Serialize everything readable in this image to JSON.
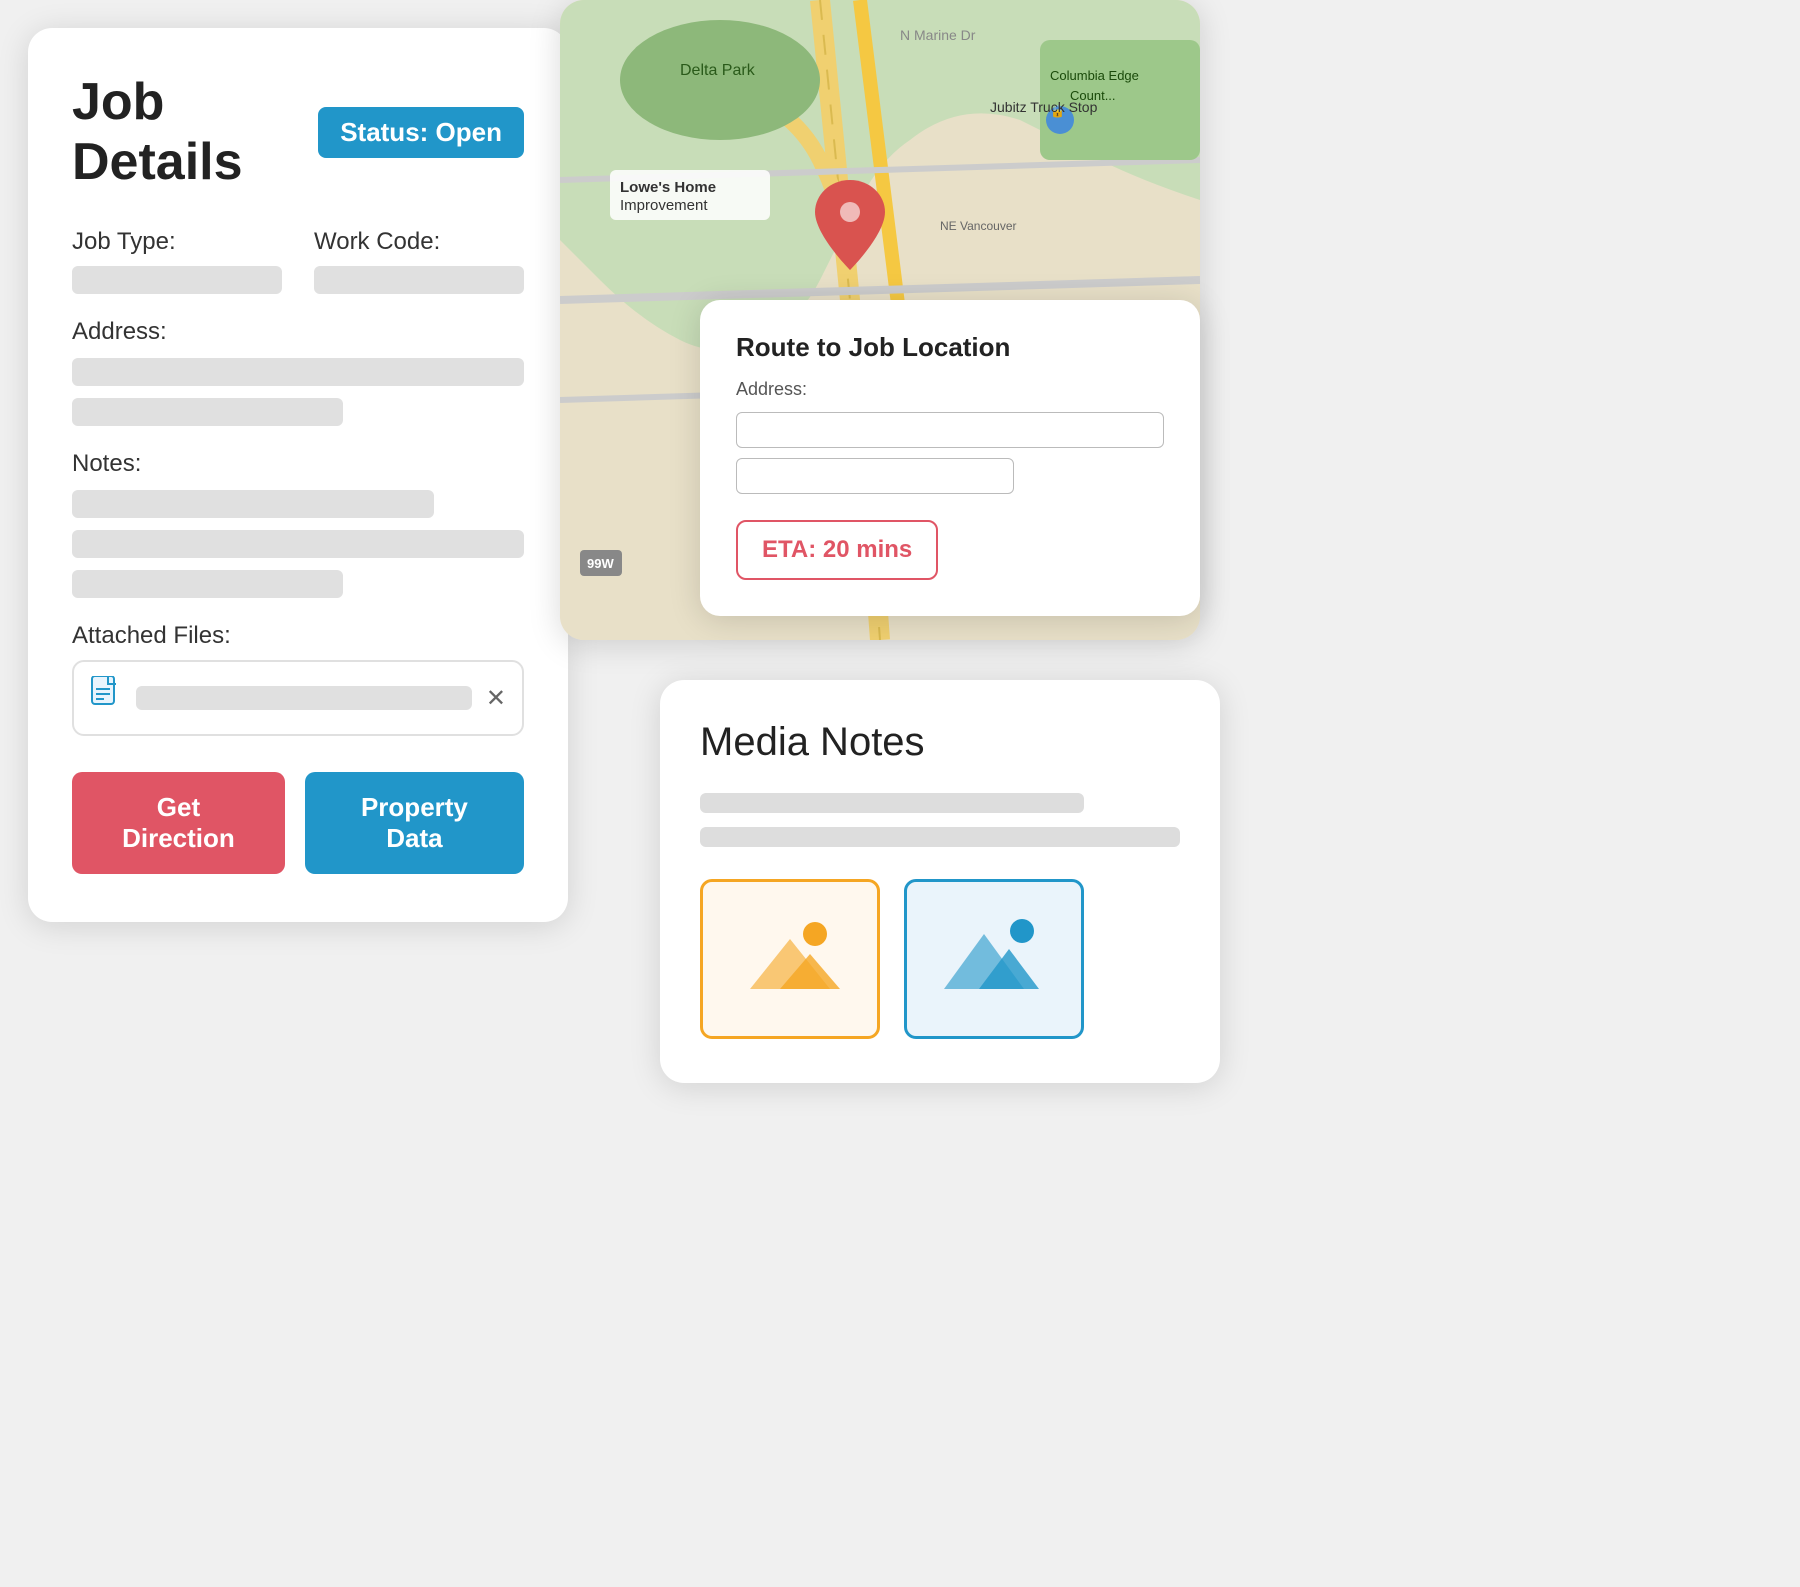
{
  "jobDetails": {
    "title": "Job Details",
    "statusLabel": "Status:",
    "statusValue": "Open",
    "fields": {
      "jobTypeLabel": "Job Type:",
      "workCodeLabel": "Work Code:",
      "addressLabel": "Address:",
      "notesLabel": "Notes:",
      "attachedFilesLabel": "Attached Files:"
    },
    "buttons": {
      "getDirection": "Get Direction",
      "propertyData": "Property Data"
    }
  },
  "routeCard": {
    "title": "Route to Job Location",
    "addressLabel": "Address:",
    "etaLabel": "ETA: 20 mins"
  },
  "mediaCard": {
    "title": "Media Notes"
  },
  "colors": {
    "blue": "#2196c9",
    "red": "#e05565",
    "orange": "#f5a623"
  },
  "icons": {
    "document": "📄",
    "close": "✕",
    "imagePlaceholderOrange": "🏔",
    "imagePlaceholderBlue": "🏔"
  }
}
